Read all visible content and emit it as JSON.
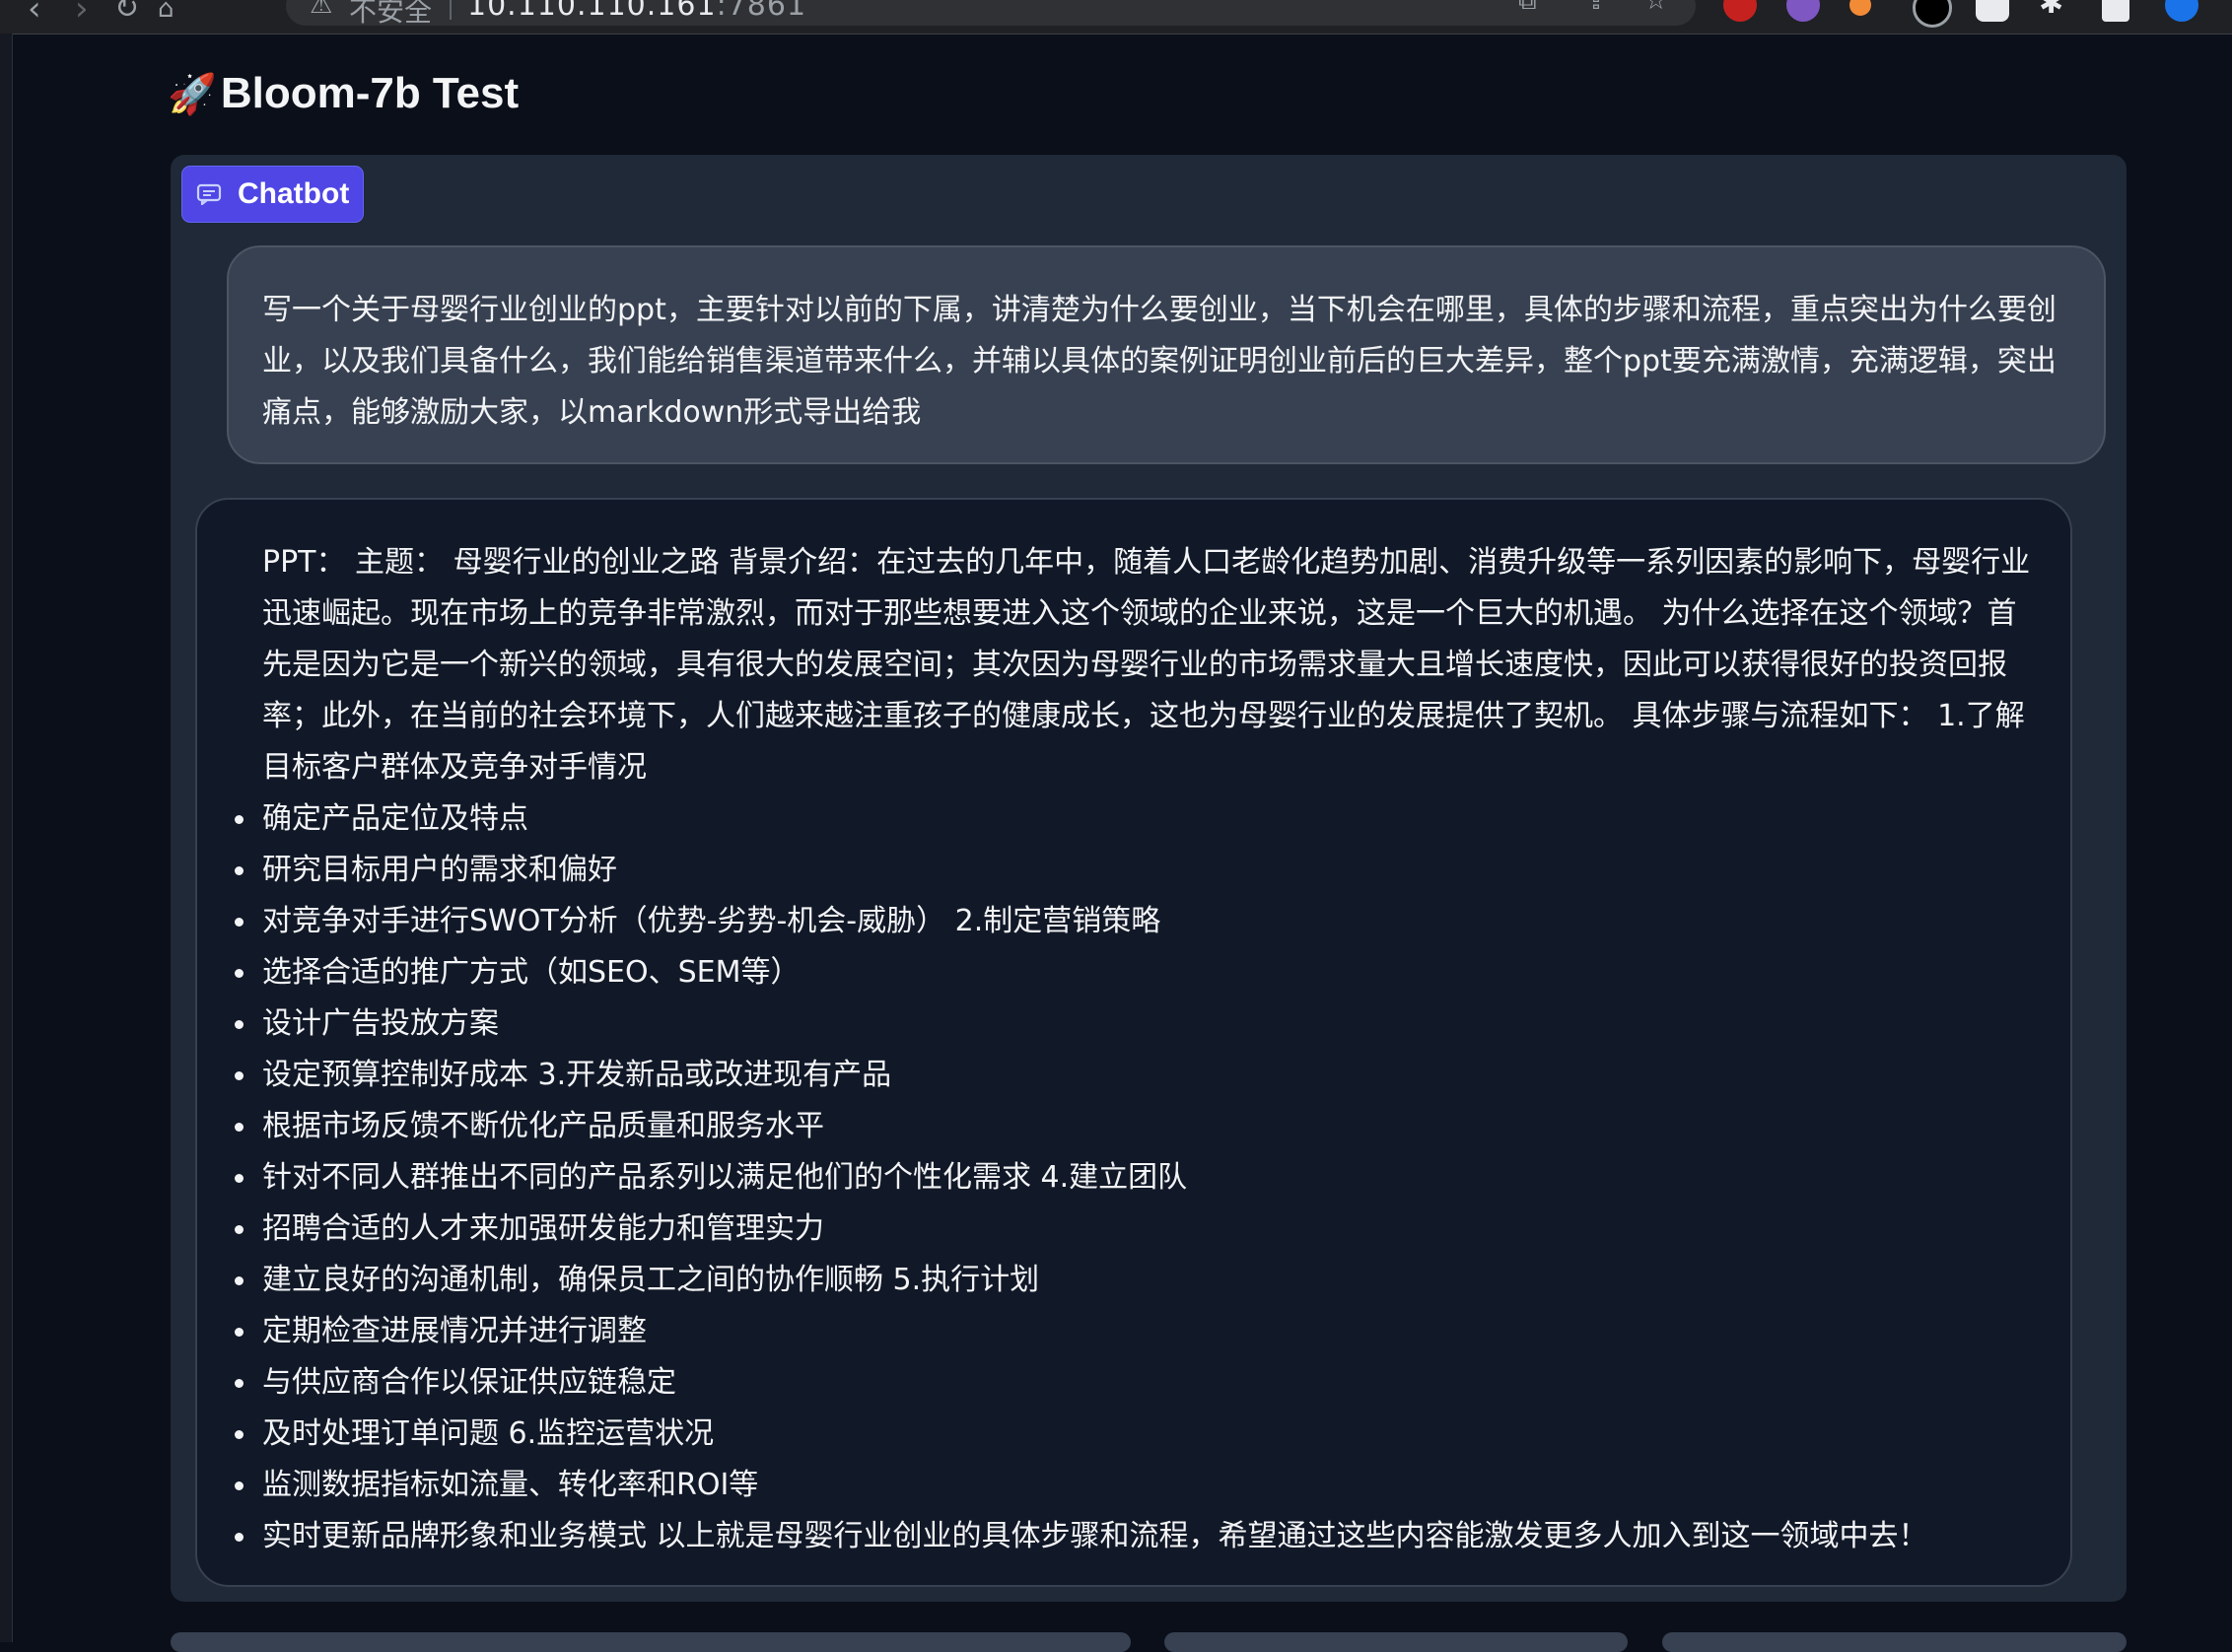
{
  "browser": {
    "security_label": "不安全",
    "url_host": "10.110.110.161",
    "url_port": ":7861"
  },
  "app": {
    "title": "Bloom-7b Test",
    "title_emoji": "🚀"
  },
  "chatbot": {
    "label": "Chatbot",
    "messages": [
      {
        "role": "user",
        "text": "写一个关于母婴行业创业的ppt，主要针对以前的下属，讲清楚为什么要创业，当下机会在哪里，具体的步骤和流程，重点突出为什么要创业，以及我们具备什么，我们能给销售渠道带来什么，并辅以具体的案例证明创业前后的巨大差异，整个ppt要充满激情，充满逻辑，突出痛点，能够激励大家，以markdown形式导出给我"
      },
      {
        "role": "bot",
        "intro": "PPT： 主题： 母婴行业的创业之路 背景介绍：在过去的几年中，随着人口老龄化趋势加剧、消费升级等一系列因素的影响下，母婴行业迅速崛起。现在市场上的竞争非常激烈，而对于那些想要进入这个领域的企业来说，这是一个巨大的机遇。 为什么选择在这个领域？首先是因为它是一个新兴的领域，具有很大的发展空间；其次因为母婴行业的市场需求量大且增长速度快，因此可以获得很好的投资回报率；此外，在当前的社会环境下，人们越来越注重孩子的健康成长，这也为母婴行业的发展提供了契机。 具体步骤与流程如下： 1.了解目标客户群体及竞争对手情况",
        "items": [
          "确定产品定位及特点",
          "研究目标用户的需求和偏好",
          "对竞争对手进行SWOT分析（优势-劣势-机会-威胁） 2.制定营销策略",
          "选择合适的推广方式（如SEO、SEM等）",
          "设计广告投放方案",
          "设定预算控制好成本 3.开发新品或改进现有产品",
          "根据市场反馈不断优化产品质量和服务水平",
          "针对不同人群推出不同的产品系列以满足他们的个性化需求 4.建立团队",
          "招聘合适的人才来加强研发能力和管理实力",
          "建立良好的沟通机制，确保员工之间的协作顺畅 5.执行计划",
          "定期检查进展情况并进行调整",
          "与供应商合作以保证供应链稳定",
          "及时处理订单问题 6.监控运营状况",
          "监测数据指标如流量、转化率和ROI等",
          "实时更新品牌形象和业务模式 以上就是母婴行业创业的具体步骤和流程，希望通过这些内容能激发更多人加入到这一领域中去！"
        ]
      }
    ]
  },
  "colors": {
    "accent": "#4f46e5",
    "page_bg": "#0b0f19",
    "panel_bg": "#1f2937",
    "user_bubble": "#374151",
    "bot_bubble": "#111827"
  }
}
